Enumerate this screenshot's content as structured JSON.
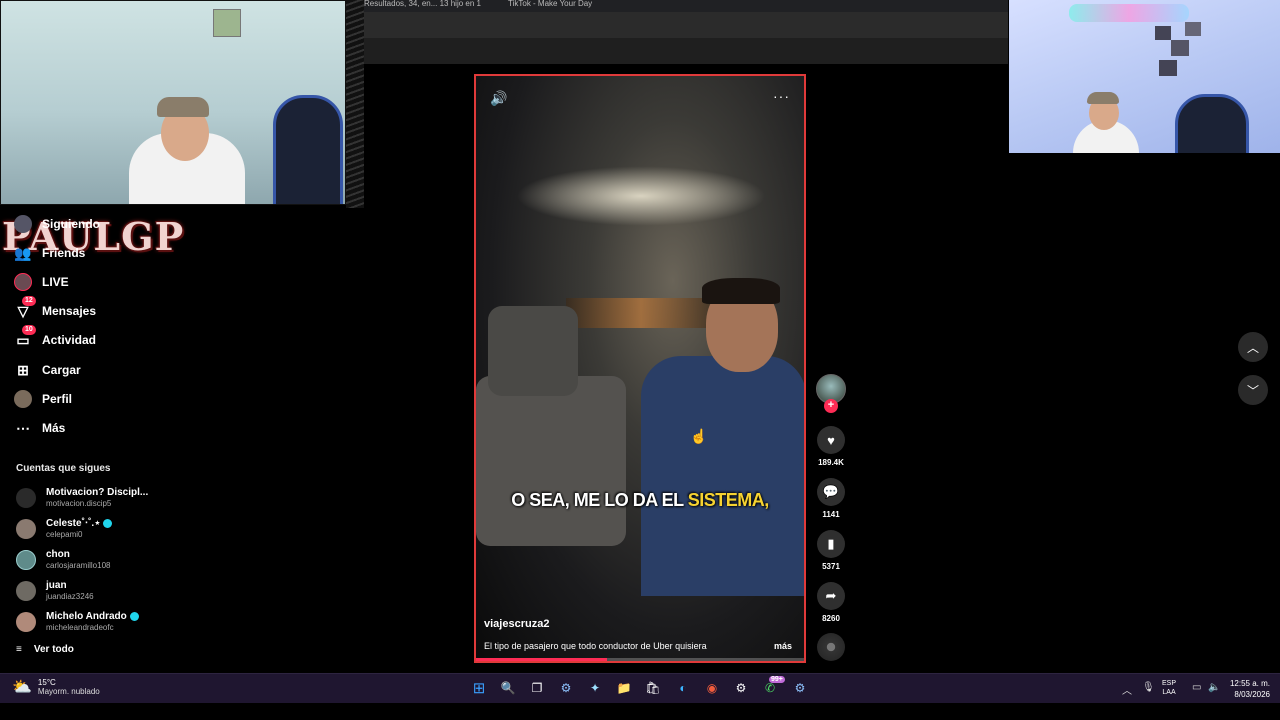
{
  "browser": {
    "tabs": [
      "Resultados, 34, en... 13 hijo en 1",
      "TikTok - Make Your Day"
    ]
  },
  "brand": {
    "logo_text": "PAULGP"
  },
  "sidebar": {
    "items": [
      {
        "label": "Siguiendo",
        "icon": "following-avatar-icon"
      },
      {
        "label": "Friends",
        "icon": "friends-icon"
      },
      {
        "label": "LIVE",
        "icon": "live-avatar-icon"
      },
      {
        "label": "Mensajes",
        "icon": "messages-icon",
        "badge": "12"
      },
      {
        "label": "Actividad",
        "icon": "activity-icon",
        "badge": "10"
      },
      {
        "label": "Cargar",
        "icon": "upload-icon"
      },
      {
        "label": "Perfil",
        "icon": "profile-avatar-icon"
      },
      {
        "label": "Más",
        "icon": "more-dots-icon"
      }
    ],
    "following_title": "Cuentas que sigues",
    "accounts": [
      {
        "name": "Motivacion? Discipl...",
        "handle": "motivacion.discip5",
        "verified": false
      },
      {
        "name": "Celeste˚‧˚.⋆",
        "handle": "celepami0",
        "verified": true
      },
      {
        "name": "chon",
        "handle": "carlosjaramillo108",
        "verified": false
      },
      {
        "name": "juan",
        "handle": "juandiaz3246",
        "verified": false
      },
      {
        "name": "Michelo Andrado",
        "handle": "micheleandradeofc",
        "verified": true
      }
    ],
    "see_all": "Ver todo"
  },
  "video": {
    "caption_plain": "O SEA, ME LO DA EL",
    "caption_highlight": "SISTEMA,",
    "username": "viajescruza2",
    "description": "El tipo de pasajero que todo conductor de Uber quisiera",
    "more_label": "más",
    "progress": 0.4
  },
  "actions": {
    "likes": "189.4K",
    "comments": "1141",
    "saves": "5371",
    "shares": "8260"
  },
  "taskbar": {
    "weather_temp": "15°C",
    "weather_desc": "Mayorm. nublado",
    "notification_badge": "99+",
    "lang_line1": "ESP",
    "lang_line2": "LAA",
    "time": "12:55 a. m.",
    "date": "8/03/2026"
  },
  "colors": {
    "accent": "#fe2c55",
    "video_border": "#e03a3a",
    "caption_highlight": "#f6d331",
    "taskbar_bg": "#1f1630"
  }
}
